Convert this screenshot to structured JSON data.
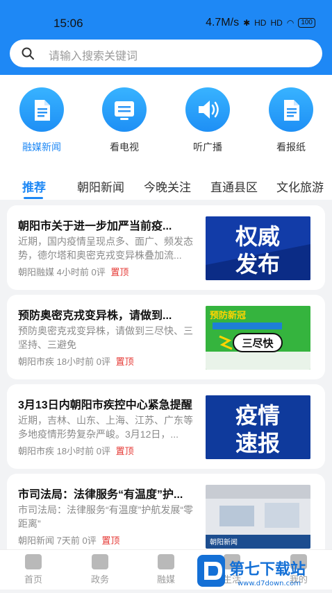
{
  "status": {
    "time": "15:06",
    "speed": "4.7M/s",
    "battery": "100",
    "signal1": "HD",
    "signal2": "HD"
  },
  "search": {
    "placeholder": "请输入搜索关键词"
  },
  "quick_nav": [
    {
      "label": "融媒新闻",
      "icon": "document-icon",
      "active": true
    },
    {
      "label": "看电视",
      "icon": "tv-icon",
      "active": false
    },
    {
      "label": "听广播",
      "icon": "speaker-icon",
      "active": false
    },
    {
      "label": "看报纸",
      "icon": "newspaper-icon",
      "active": false
    }
  ],
  "tabs": [
    "推荐",
    "朝阳新闻",
    "今晚关注",
    "直通县区",
    "文化旅游"
  ],
  "news": [
    {
      "title": "朝阳市关于进一步加严当前疫...",
      "summary": "近期，国内疫情呈现点多、面广、频发态势，德尔塔和奥密克戎变异株叠加流...",
      "source": "朝阳融媒",
      "time": "4小时前",
      "comments": "0评",
      "pin": "置顶",
      "thumb_text": [
        "权威",
        "发布"
      ]
    },
    {
      "title": "预防奥密克戎变异株，请做到...",
      "summary": "预防奥密克戎变异株，请做到三尽快、三坚持、三避免",
      "source": "朝阳市疾",
      "time": "18小时前",
      "comments": "0评",
      "pin": "置顶",
      "thumb_text": [
        "预防新冠",
        "三尽快"
      ]
    },
    {
      "title": "3月13日内朝阳市疾控中心紧急提醒",
      "summary": "近期，吉林、山东、上海、江苏、广东等多地疫情形势复杂严峻。3月12日，...",
      "source": "朝阳市疾",
      "time": "18小时前",
      "comments": "0评",
      "pin": "置顶",
      "thumb_text": [
        "疫情",
        "速报"
      ]
    },
    {
      "title": "市司法局：法律服务“有温度”护...",
      "summary": "市司法局：法律服务“有温度”护航发展“零距离”",
      "source": "朝阳新闻",
      "time": "7天前",
      "comments": "0评",
      "pin": "置顶",
      "thumb_text": [
        "朝阳新闻"
      ]
    }
  ],
  "bottom_nav": [
    {
      "label": "首页",
      "icon": "home-icon"
    },
    {
      "label": "政务",
      "icon": "government-icon"
    },
    {
      "label": "融媒",
      "icon": "media-icon"
    },
    {
      "label": "生活",
      "icon": "life-icon"
    },
    {
      "label": "我的",
      "icon": "user-icon"
    }
  ],
  "watermark": {
    "text": "第七下载站",
    "url": "www.d7down.com"
  },
  "colors": {
    "accent": "#1e88f5",
    "pin": "#e53935",
    "header": "#1e88f5"
  }
}
